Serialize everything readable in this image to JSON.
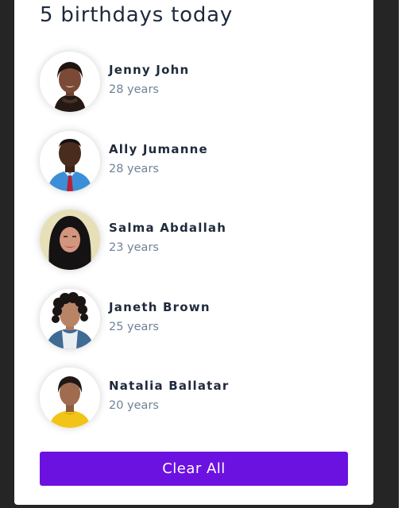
{
  "title": "5 birthdays today",
  "people": [
    {
      "name": "Jenny John",
      "age": "28 years",
      "avatar": "portrait-woman-icon"
    },
    {
      "name": "Ally Jumanne",
      "age": "28 years",
      "avatar": "portrait-man-icon"
    },
    {
      "name": "Salma Abdallah",
      "age": "23 years",
      "avatar": "portrait-woman-hijab-icon"
    },
    {
      "name": "Janeth Brown",
      "age": "25 years",
      "avatar": "portrait-woman-curly-icon"
    },
    {
      "name": "Natalia Ballatar",
      "age": "20 years",
      "avatar": "portrait-woman-icon"
    }
  ],
  "button": {
    "label": "Clear All"
  },
  "colors": {
    "page_background": "#252525",
    "card_background": "#ffffff",
    "title_text": "#1f2a3c",
    "age_text": "#6f8297",
    "button_background": "#6c12e0",
    "button_text": "#ffffff"
  }
}
